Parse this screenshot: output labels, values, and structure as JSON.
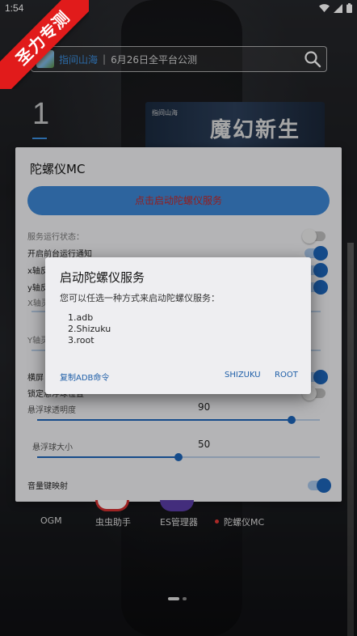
{
  "status_bar": {
    "time": "1:54",
    "icons": [
      "wifi-icon",
      "signal-icon",
      "battery-icon"
    ]
  },
  "ribbon": {
    "text": "圣力专测"
  },
  "launcher": {
    "search_app_name": "指间山海",
    "search_separator": "|",
    "search_news": "6月26日全平台公测",
    "big_number": "1",
    "banner_title": "魔幻新生",
    "banner_small": "指间山海"
  },
  "gyro_panel": {
    "title": "陀螺仪MC",
    "start_button": "点击启动陀螺仪服务",
    "rows": {
      "service_status": "服务运行状态：",
      "foreground_notify": "开启前台运行通知",
      "x_axis_invert": "x轴反",
      "y_axis_invert": "y轴反",
      "x_axis_sensitivity": "X轴灵",
      "y_axis_sensitivity": "Y轴灵",
      "horizontal": "横屏",
      "lock": "锁定悬浮球位置"
    },
    "float_alpha": {
      "label": "悬浮球透明度",
      "value": "90",
      "fraction": 0.9
    },
    "float_size": {
      "label": "悬浮球大小",
      "value": "50",
      "fraction": 0.5
    },
    "volume_key": "音量键映射"
  },
  "dock": {
    "items": [
      {
        "label": "OGM"
      },
      {
        "label": "虫虫助手"
      },
      {
        "label": "ES管理器"
      },
      {
        "label": "陀螺仪MC"
      }
    ]
  },
  "dialog": {
    "title": "启动陀螺仪服务",
    "message": "您可以任选一种方式来启动陀螺仪服务：",
    "options": [
      "1.adb",
      "2.Shizuku",
      "3.root"
    ],
    "copy_adb_button": "复制ADB命令",
    "shizuku_button": "SHIZUKU",
    "root_button": "ROOT"
  },
  "colors": {
    "accent": "#1d64b8",
    "button_blue": "#3c86d3",
    "ribbon_red": "#e11b1b",
    "link_blue": "#3b8fe0"
  }
}
